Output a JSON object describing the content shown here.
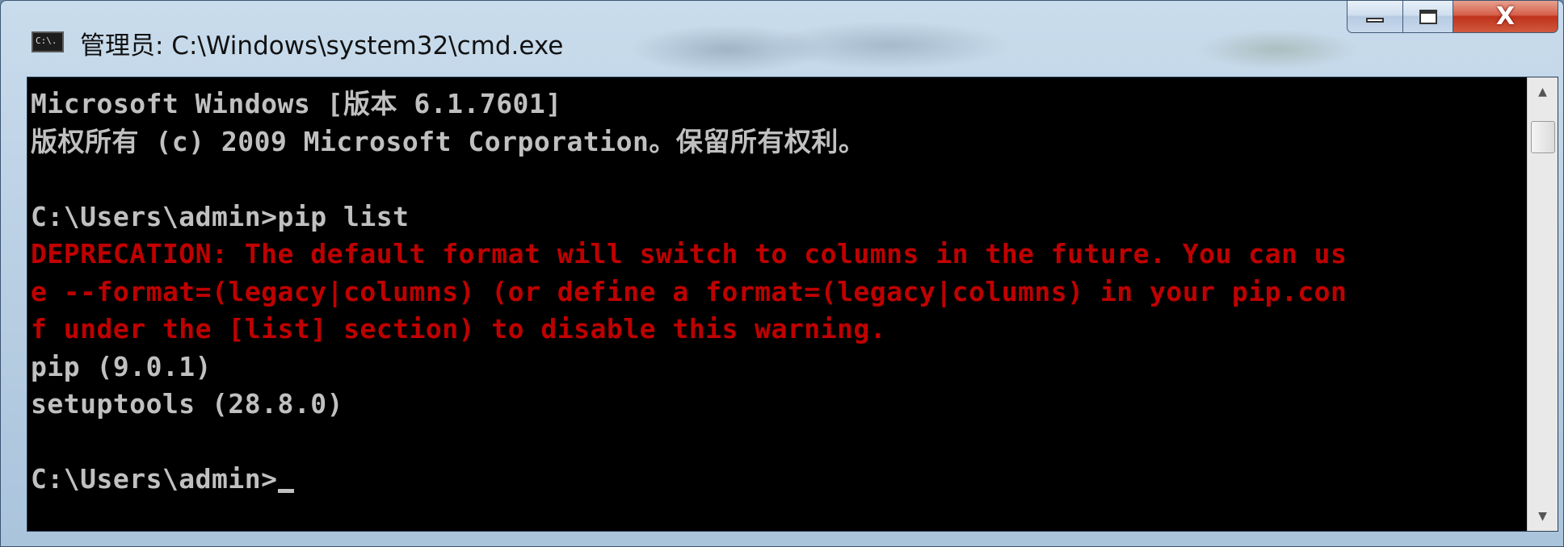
{
  "window": {
    "title": "管理员: C:\\Windows\\system32\\cmd.exe",
    "icon": "cmd-icon",
    "icon_text": "C:\\.",
    "buttons": {
      "minimize": "minimize-icon",
      "maximize": "maximize-icon",
      "close_label": "X"
    }
  },
  "console": {
    "lines": [
      {
        "text": "Microsoft Windows [版本 6.1.7601]",
        "color": "#c0c0c0"
      },
      {
        "text": "版权所有 (c) 2009 Microsoft Corporation。保留所有权利。",
        "color": "#c0c0c0"
      },
      {
        "text": "",
        "color": "#c0c0c0"
      },
      {
        "text": "C:\\Users\\admin>pip list",
        "color": "#c0c0c0"
      },
      {
        "text": "DEPRECATION: The default format will switch to columns in the future. You can us",
        "color": "#c00000"
      },
      {
        "text": "e --format=(legacy|columns) (or define a format=(legacy|columns) in your pip.con",
        "color": "#c00000"
      },
      {
        "text": "f under the [list] section) to disable this warning.",
        "color": "#c00000"
      },
      {
        "text": "pip (9.0.1)",
        "color": "#c0c0c0"
      },
      {
        "text": "setuptools (28.8.0)",
        "color": "#c0c0c0"
      },
      {
        "text": "",
        "color": "#c0c0c0"
      },
      {
        "text": "C:\\Users\\admin>",
        "color": "#c0c0c0"
      }
    ],
    "prompt_cursor": true
  },
  "colors": {
    "console_bg": "#000000",
    "text": "#c0c0c0",
    "warning": "#c00000",
    "close_button": "#c0321b"
  }
}
